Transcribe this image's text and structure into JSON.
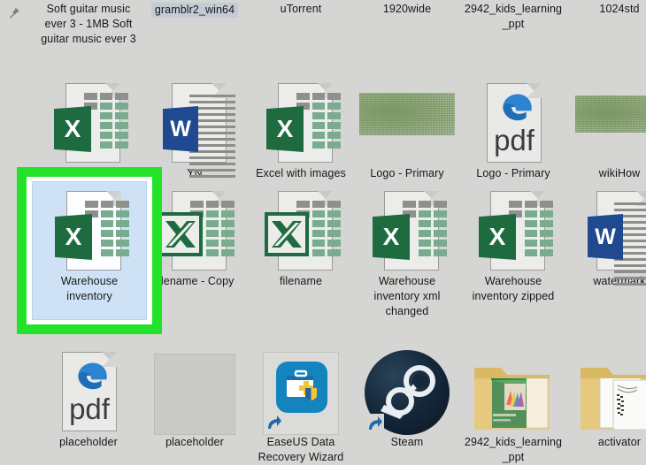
{
  "window": {
    "background_color": "#d5d5d3",
    "selected_label_bg": "#c3ccd6",
    "highlight_color": "#22e22a",
    "selection_fill": "#cfe2f5"
  },
  "icons": {
    "pin": "pin-icon",
    "excel_letter": "X",
    "word_letter": "W",
    "pdf_text": "pdf",
    "edge_logo": "edge-e-logo",
    "shortcut_overlay": "shortcut-arrow-icon"
  },
  "rows": {
    "row1_labels": [
      {
        "name": "soft-guitar",
        "text": "Soft guitar music ever 3 - 1MB Soft guitar music ever 3",
        "selected": false
      },
      {
        "name": "gramblr",
        "text": "gramblr2_win64",
        "selected": true
      },
      {
        "name": "utorrent",
        "text": "uTorrent",
        "selected": false
      },
      {
        "name": "wide",
        "text": "1920wide",
        "selected": false
      },
      {
        "name": "kids-ppt",
        "text": "2942_kids_learning_ppt",
        "selected": false
      },
      {
        "name": "std",
        "text": "1024std",
        "selected": false
      }
    ],
    "row2": [
      {
        "name": "excel-unnamed",
        "label": "",
        "kind": "excel"
      },
      {
        "name": "yn",
        "label": "YN",
        "kind": "word"
      },
      {
        "name": "excel-with-images",
        "label": "Excel with images",
        "kind": "excel"
      },
      {
        "name": "logo-primary-a",
        "label": "Logo - Primary",
        "kind": "image"
      },
      {
        "name": "logo-primary-b",
        "label": "Logo - Primary",
        "kind": "pdf"
      },
      {
        "name": "wikihow",
        "label": "wikiHow",
        "kind": "image"
      }
    ],
    "row3": [
      {
        "name": "warehouse-inventory",
        "label": "Warehouse inventory",
        "kind": "excel",
        "selected": true
      },
      {
        "name": "filename-copy",
        "label": "filename - Copy",
        "kind": "excel-legacy"
      },
      {
        "name": "filename",
        "label": "filename",
        "kind": "excel-legacy"
      },
      {
        "name": "warehouse-xml-changed",
        "label": "Warehouse inventory xml changed",
        "kind": "excel"
      },
      {
        "name": "warehouse-zipped",
        "label": "Warehouse inventory zipped",
        "kind": "excel"
      },
      {
        "name": "watermark",
        "label": "watermark",
        "kind": "word"
      }
    ],
    "row4": [
      {
        "name": "placeholder-pdf",
        "label": "placeholder",
        "kind": "pdf"
      },
      {
        "name": "placeholder-blank",
        "label": "placeholder",
        "kind": "blank"
      },
      {
        "name": "easeus",
        "label": "EaseUS Data Recovery Wizard",
        "kind": "app-shortcut"
      },
      {
        "name": "steam",
        "label": "Steam",
        "kind": "steam-shortcut"
      },
      {
        "name": "kids-ppt-folder",
        "label": "2942_kids_learning_ppt",
        "kind": "folder"
      },
      {
        "name": "activator-folder",
        "label": "activator",
        "kind": "folder"
      }
    ]
  }
}
